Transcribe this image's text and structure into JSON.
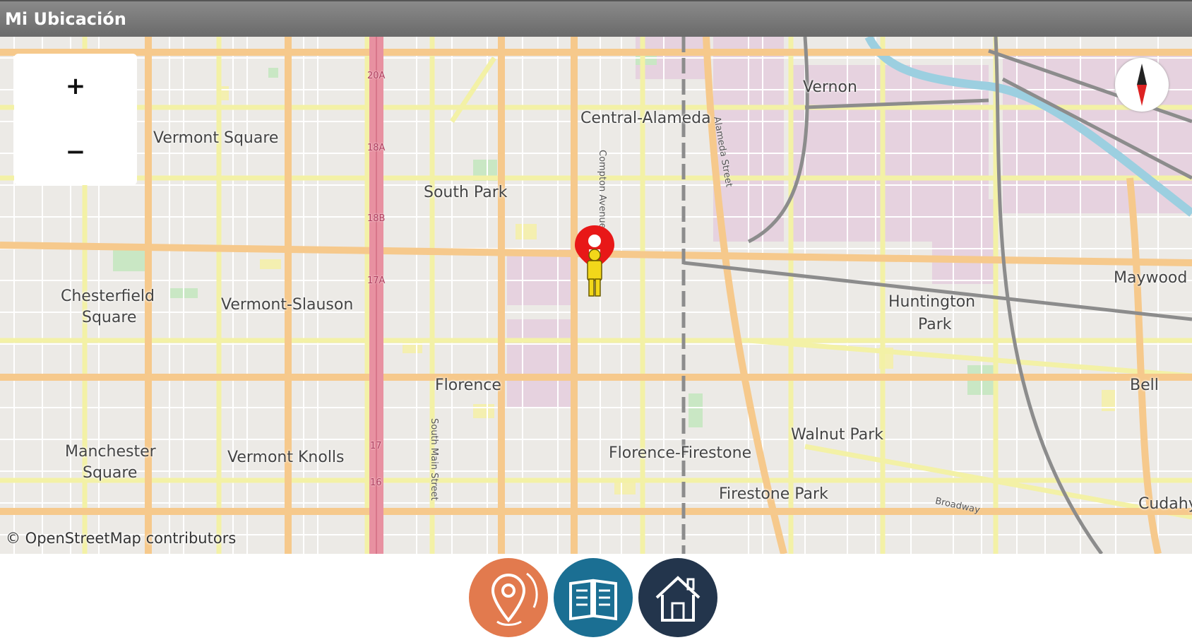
{
  "window": {
    "title": "Mi Ubicación"
  },
  "map": {
    "places": [
      {
        "id": "vermont-square",
        "text": "Vermont Square"
      },
      {
        "id": "central-alameda",
        "text": "Central-Alameda"
      },
      {
        "id": "vernon",
        "text": "Vernon"
      },
      {
        "id": "south-park",
        "text": "South Park"
      },
      {
        "id": "chesterfield-square-1",
        "text": "Chesterfield"
      },
      {
        "id": "chesterfield-square-2",
        "text": "Square"
      },
      {
        "id": "vermont-slauson",
        "text": "Vermont-Slauson"
      },
      {
        "id": "huntington-park-1",
        "text": "Huntington"
      },
      {
        "id": "huntington-park-2",
        "text": "Park"
      },
      {
        "id": "maywood",
        "text": "Maywood"
      },
      {
        "id": "florence",
        "text": "Florence"
      },
      {
        "id": "bell",
        "text": "Bell"
      },
      {
        "id": "walnut-park",
        "text": "Walnut Park"
      },
      {
        "id": "manchester-square-1",
        "text": "Manchester"
      },
      {
        "id": "manchester-square-2",
        "text": "Square"
      },
      {
        "id": "vermont-knolls",
        "text": "Vermont Knolls"
      },
      {
        "id": "florence-firestone",
        "text": "Florence-Firestone"
      },
      {
        "id": "firestone-park",
        "text": "Firestone Park"
      },
      {
        "id": "cudahy",
        "text": "Cudahy"
      }
    ],
    "streets": [
      {
        "id": "compton-avenue",
        "text": "Compton Avenue"
      },
      {
        "id": "alameda-street",
        "text": "Alameda Street"
      },
      {
        "id": "south-main-street",
        "text": "South Main Street"
      },
      {
        "id": "broadway",
        "text": "Broadway"
      }
    ],
    "highway_shields": [
      "20A",
      "18A",
      "18B",
      "17A",
      "17",
      "16"
    ],
    "zoom_in_label": "+",
    "zoom_out_label": "−",
    "attribution": "© OpenStreetMap contributors",
    "colors": {
      "land": "#eceae6",
      "industrial": "#e6d2df",
      "major_road": "#f6c98c",
      "secondary_road": "#f3f1a6",
      "freeway": "#e891a1",
      "railway": "#8c8c8c",
      "river": "#9ccfe0",
      "park": "#c9e7c4"
    }
  },
  "bottom_nav": {
    "items": [
      {
        "name": "location-pin-button",
        "icon": "location-pin-icon",
        "color": "#e27a4e"
      },
      {
        "name": "book-button",
        "icon": "book-icon",
        "color": "#1b6f93"
      },
      {
        "name": "home-button",
        "icon": "home-icon",
        "color": "#23354c"
      }
    ]
  }
}
